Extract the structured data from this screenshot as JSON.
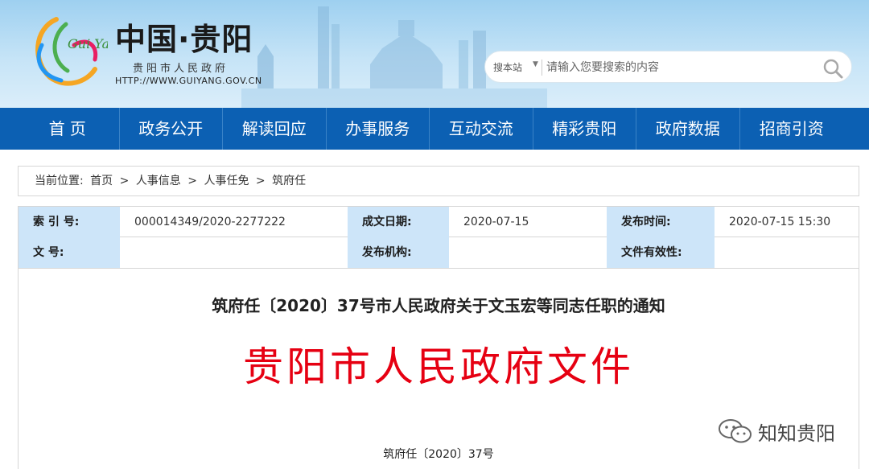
{
  "header": {
    "site_title": "中国·贵阳",
    "site_subtitle": "贵阳市人民政府",
    "site_url": "HTTP://WWW.GUIYANG.GOV.CN",
    "logo_text": "Gui Yang",
    "accent_color": "#0c60b3"
  },
  "search": {
    "scope": "搜本站",
    "scope_arrow": "▼",
    "placeholder": "请输入您要搜索的内容",
    "icon": "search-icon"
  },
  "nav": {
    "items": [
      "首 页",
      "政务公开",
      "解读回应",
      "办事服务",
      "互动交流",
      "精彩贵阳",
      "政府数据",
      "招商引资"
    ]
  },
  "breadcrumb": {
    "prefix": "当前位置:",
    "items": [
      "首页",
      "人事信息",
      "人事任免",
      "筑府任"
    ],
    "separator": ">"
  },
  "meta": {
    "index_label": "索 引 号:",
    "index_value": "000014349/2020-2277222",
    "date_label": "成文日期:",
    "date_value": "2020-07-15",
    "publish_label": "发布时间:",
    "publish_value": "2020-07-15 15:30",
    "docno_label": "文 号:",
    "docno_value": "",
    "org_label": "发布机构:",
    "org_value": "",
    "validity_label": "文件有效性:",
    "validity_value": ""
  },
  "document": {
    "title": "筑府任〔2020〕37号市人民政府关于文玉宏等同志任职的通知",
    "red_header": "贵阳市人民政府文件",
    "header_color": "#e60012",
    "number": "筑府任〔2020〕37号"
  },
  "watermark": {
    "text": "知知贵阳",
    "icon": "wechat-icon"
  }
}
